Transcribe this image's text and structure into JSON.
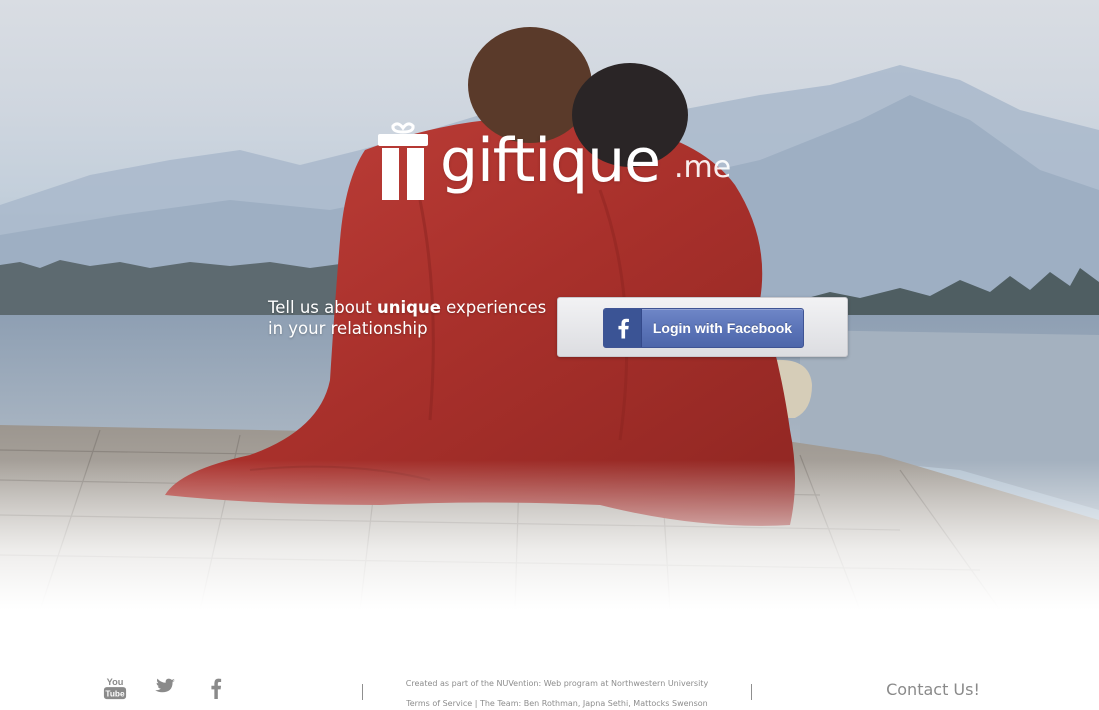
{
  "brand": {
    "name": "giftique",
    "tld": ".me",
    "logo_icon": "gift-box-icon"
  },
  "hero": {
    "tagline_pre": "Tell us about",
    "tagline_em": "unique",
    "tagline_post": "experiences",
    "tagline_line2": "in your relationship",
    "login_label": "Login with Facebook",
    "login_icon": "facebook-f-icon"
  },
  "footer": {
    "social": [
      {
        "name": "YouTube",
        "icon": "youtube-icon"
      },
      {
        "name": "Twitter",
        "icon": "twitter-bird-icon"
      },
      {
        "name": "Facebook",
        "icon": "facebook-f-icon"
      }
    ],
    "credit": "Created as part of the NUVention: Web program at Northwestern University",
    "links": "Terms of Service | The Team: Ben Rothman, Japna Sethi, Mattocks Swenson",
    "contact": "Contact Us!"
  },
  "colors": {
    "facebook_blue": "#3b5495",
    "blanket_red": "#b0342e",
    "footer_text": "#8d8d8d"
  }
}
